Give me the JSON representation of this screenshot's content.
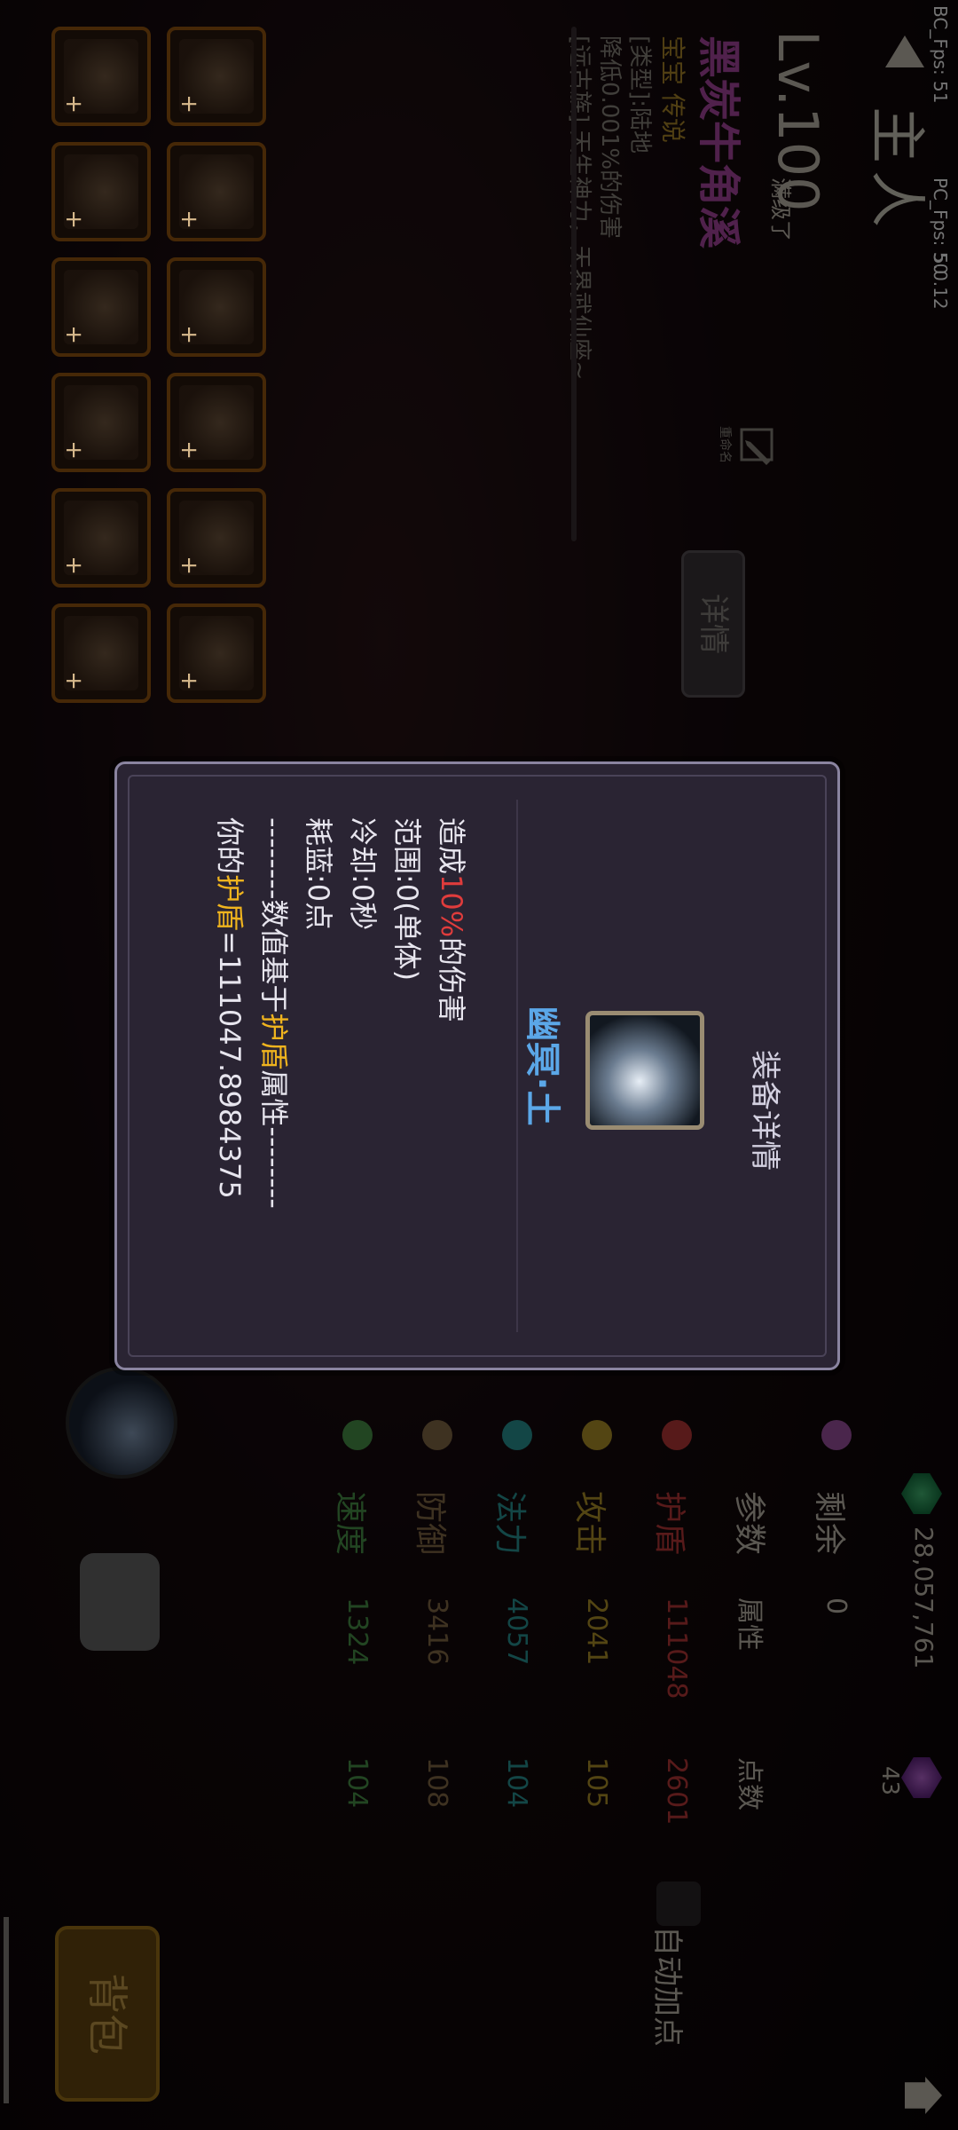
{
  "debug": {
    "bc_fps": "BC_Fps: 51",
    "pc_fps": "PC_Fps: 50",
    "version": "5.0.12"
  },
  "header": {
    "title": "主人"
  },
  "pet": {
    "level": "Lv.100",
    "level_suffix": "满级了",
    "name": "黑炭牛角溪",
    "subtitle": "宝宝 传说",
    "type_line": "[类型]:陆地",
    "passive_line": "降低0.001%的伤害",
    "clan_line": "[远古族] 天生神力，天界武仙座~",
    "rename_label": "重命名",
    "detail_button": "详情"
  },
  "equipment": {
    "slots": [
      "+",
      "+",
      "+",
      "+",
      "+",
      "+",
      "+",
      "+",
      "+",
      "+",
      "+",
      "+"
    ]
  },
  "resources": {
    "gold": "28,057,761",
    "crystal": "43"
  },
  "stats": {
    "header": {
      "label": "剩余",
      "v1": "0"
    },
    "columns": {
      "param": "参数",
      "attr": "属性",
      "points": "点数"
    },
    "rows": [
      {
        "label": "护盾",
        "value": "111048",
        "points": "2601",
        "color": "#c23a3a",
        "icon": "heart-icon"
      },
      {
        "label": "攻击",
        "value": "2041",
        "points": "105",
        "color": "#b89a2a",
        "icon": "sword-icon"
      },
      {
        "label": "法力",
        "value": "4057",
        "points": "104",
        "color": "#2a9b9b",
        "icon": "gear-icon"
      },
      {
        "label": "防御",
        "value": "3416",
        "points": "108",
        "color": "#8b6f4a",
        "icon": "shield-icon"
      },
      {
        "label": "速度",
        "value": "1324",
        "points": "104",
        "color": "#4d9a4d",
        "icon": "star-icon"
      }
    ],
    "auto_label": "自动加点"
  },
  "bag_button": "背包",
  "modal": {
    "title": "装备详情",
    "item_name": "幽冥·土",
    "desc": {
      "l1_a": "造成",
      "l1_b": "10%",
      "l1_c": "的伤害",
      "l2": "范围:0(单体)",
      "l3": "冷却:0秒",
      "l4": "耗蓝:0点",
      "l5_a": "--------数值基于",
      "l5_b": "护盾",
      "l5_c": "属性--------",
      "l6_a": "你的",
      "l6_b": "护盾",
      "l6_c": "=111047.8984375"
    }
  }
}
